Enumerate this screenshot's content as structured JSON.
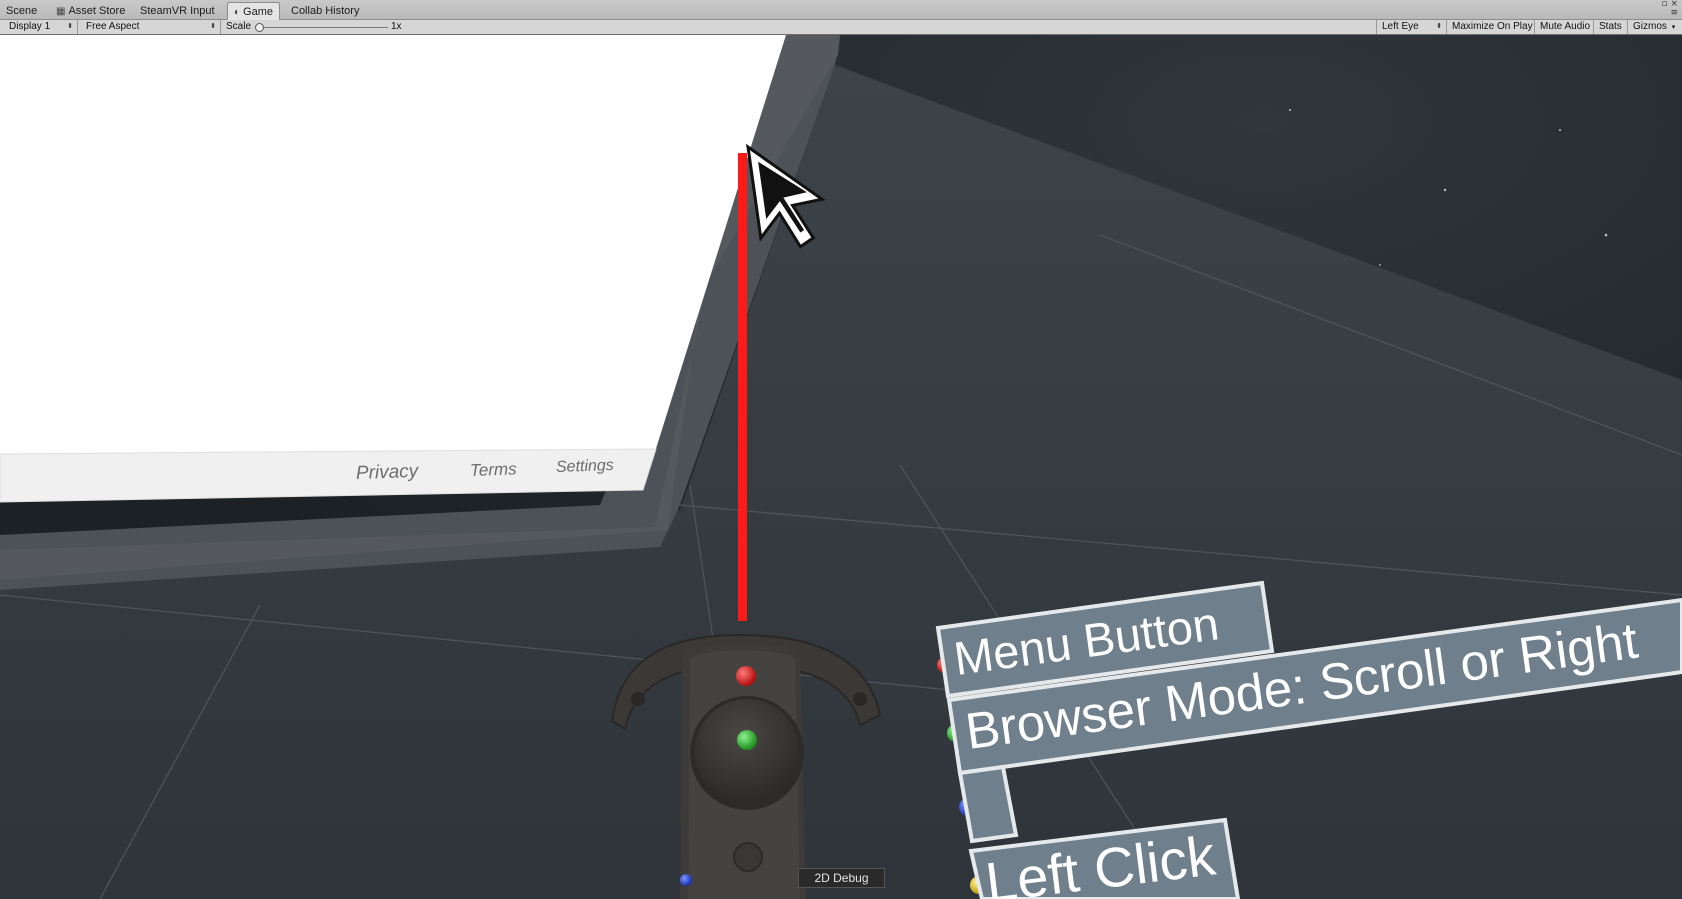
{
  "tabs": [
    {
      "label": "Scene",
      "icon": ""
    },
    {
      "label": "Asset Store",
      "icon": "store-icon"
    },
    {
      "label": "SteamVR Input",
      "icon": ""
    },
    {
      "label": "Game",
      "icon": "game-controller-icon",
      "active": true
    },
    {
      "label": "Collab History",
      "icon": ""
    }
  ],
  "toolbar": {
    "display": "Display 1",
    "aspect": "Free Aspect",
    "scale_label": "Scale",
    "scale_value": "1x",
    "eye": "Left Eye",
    "maximize": "Maximize On Play",
    "mute": "Mute Audio",
    "stats": "Stats",
    "gizmos": "Gizmos"
  },
  "browser": {
    "links": [
      "Privacy",
      "Terms",
      "Settings"
    ]
  },
  "vr_labels": {
    "menu": "Menu Button",
    "browser_mode": "Browser Mode: Scroll or Right",
    "left_click": "Left Click"
  },
  "debug_button": "2D Debug",
  "colors": {
    "laser": "#ff1a1a",
    "dot_red": "#d81818",
    "dot_green": "#2fb52f",
    "dot_blue": "#1f3fcf",
    "dot_yellow": "#e0c41a",
    "label_bg": "#6f7f8b"
  }
}
